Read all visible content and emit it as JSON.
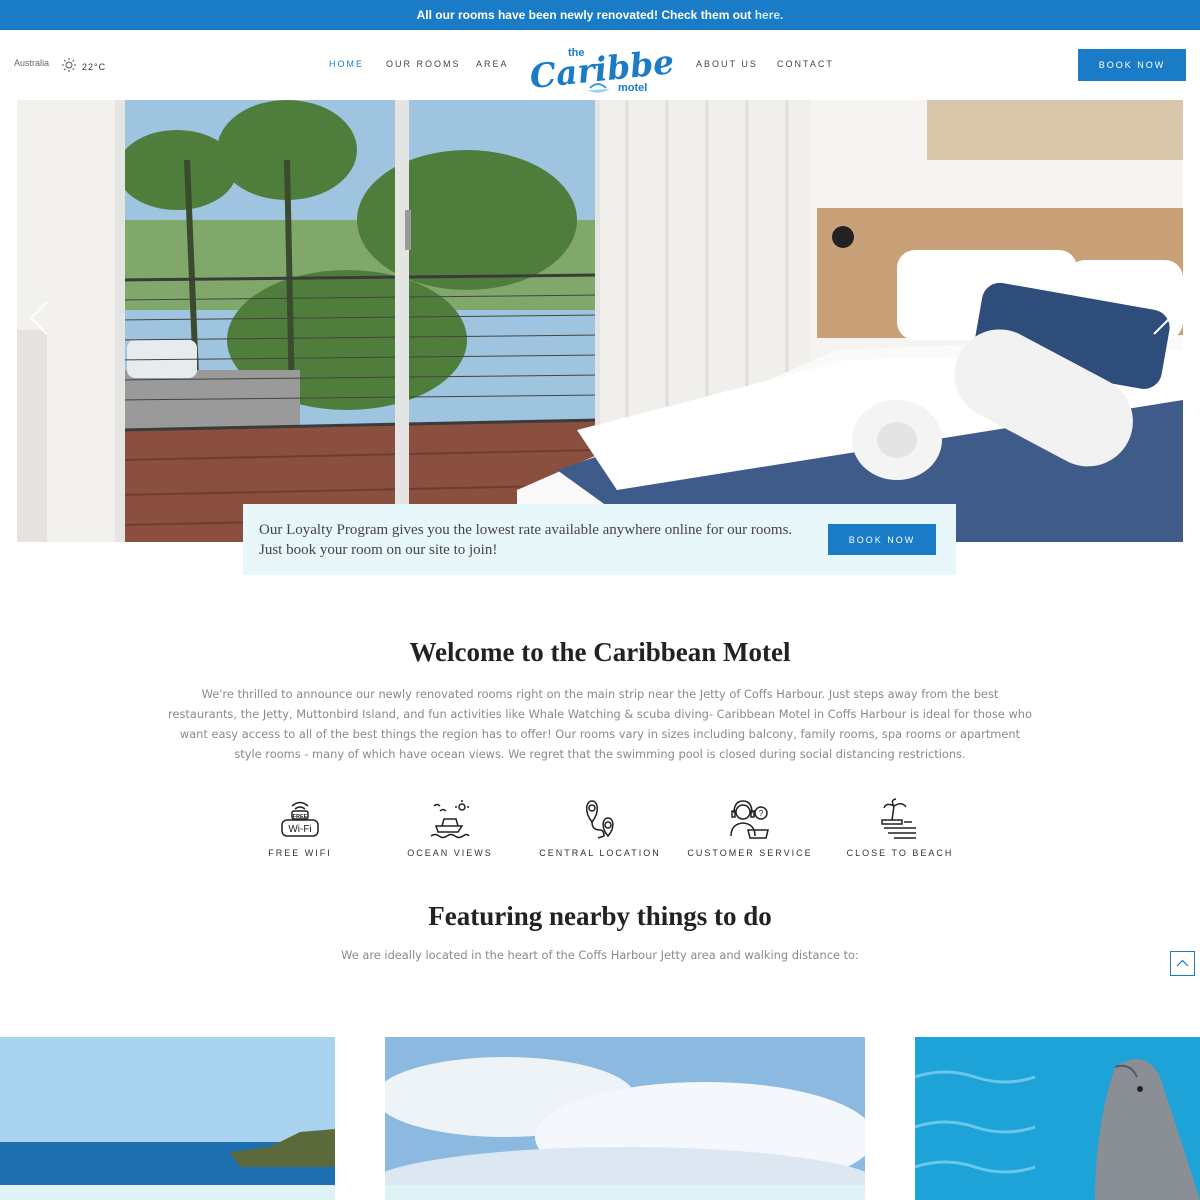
{
  "announcement": {
    "text": "All our rooms have been newly renovated! Check them out ",
    "link": "here."
  },
  "header": {
    "location": "Australia",
    "temperature": "22°C",
    "weather_icon": "sun-icon",
    "nav": [
      "HOME",
      "OUR ROOMS",
      "AREA",
      "ABOUT US",
      "CONTACT"
    ],
    "active_nav": "HOME",
    "logo": {
      "line1": "the",
      "line2": "Caribbean",
      "line3": "motel"
    },
    "book_label": "BOOK NOW"
  },
  "hero": {
    "promo_text": "Our Loyalty Program gives you the lowest rate available anywhere online for our rooms. Just book your room on our site to join!",
    "promo_button": "BOOK NOW"
  },
  "welcome": {
    "title": "Welcome to the Caribbean Motel",
    "body": "We're thrilled to announce our newly renovated rooms right on the main strip near the Jetty of Coffs Harbour. Just steps away from the best restaurants, the Jetty, Muttonbird Island, and fun activities like Whale Watching & scuba diving- Caribbean Motel in Coffs Harbour is ideal for those who want easy access to all of the best things the region has to offer! Our rooms vary in sizes including balcony, family rooms, spa rooms or apartment style rooms - many of which have ocean views. We regret that the swimming pool is closed during social distancing restrictions."
  },
  "features": [
    {
      "label": "FREE WIFI",
      "icon": "wifi-icon",
      "badge_top": "FREE",
      "badge_bottom": "Wi-Fi"
    },
    {
      "label": "OCEAN VIEWS",
      "icon": "boat-icon"
    },
    {
      "label": "CENTRAL LOCATION",
      "icon": "location-pin-icon"
    },
    {
      "label": "CUSTOMER SERVICE",
      "icon": "support-agent-icon"
    },
    {
      "label": "CLOSE TO BEACH",
      "icon": "palm-beach-icon"
    }
  ],
  "nearby": {
    "title": "Featuring nearby things to do",
    "subtitle": "We are ideally located in the heart of the Coffs Harbour Jetty area and walking distance to:"
  },
  "colors": {
    "brand_blue": "#1a7bc7",
    "promo_bg": "#e8f7f9"
  }
}
